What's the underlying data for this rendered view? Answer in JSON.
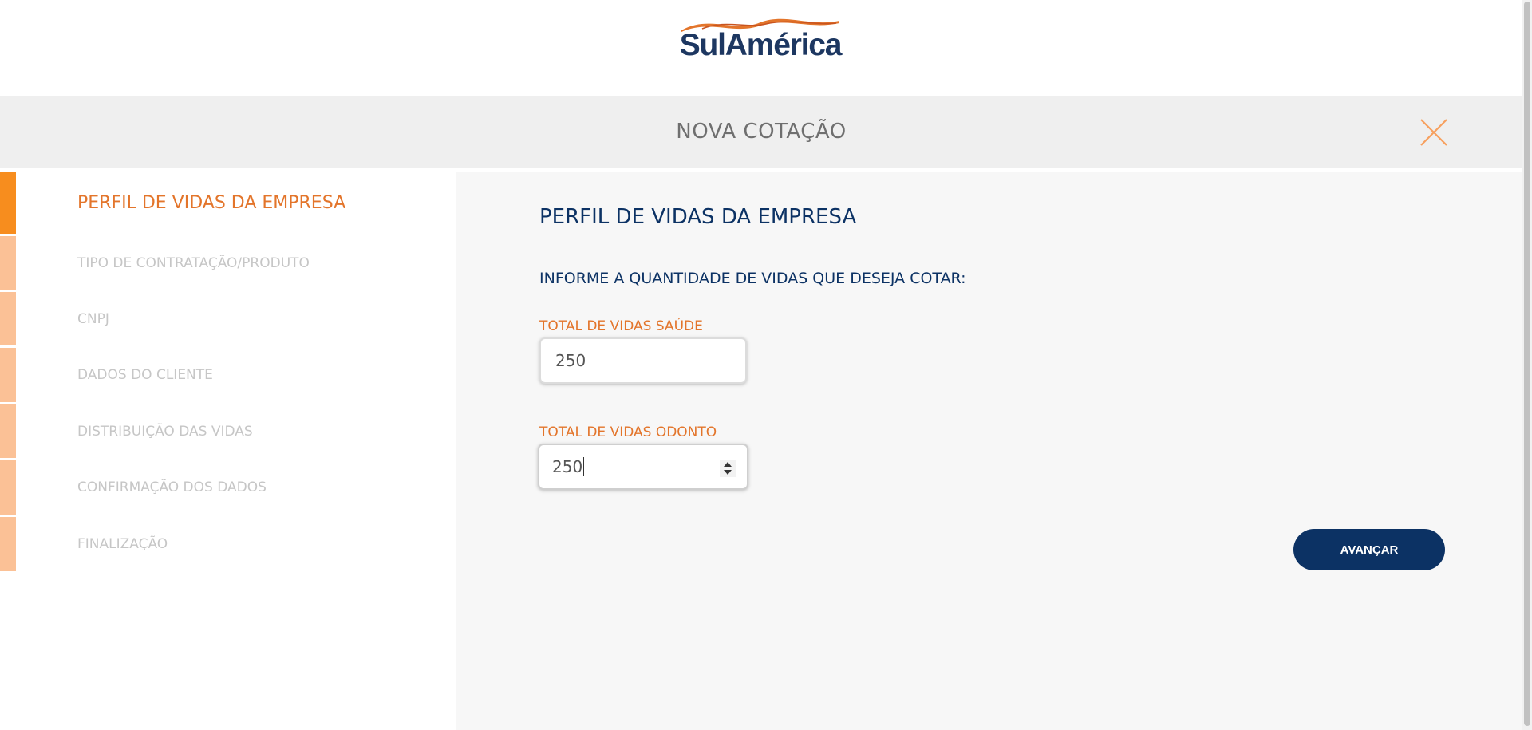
{
  "brand": {
    "name": "SulAmérica",
    "colors": {
      "navy": "#1d3761",
      "orange": "#e3752b",
      "accent": "#f78d1e",
      "button": "#0c3264"
    }
  },
  "header": {
    "title": "NOVA COTAÇÃO",
    "close_icon": "close-icon"
  },
  "steps": [
    {
      "label": "PERFIL DE VIDAS DA EMPRESA",
      "active": true
    },
    {
      "label": "TIPO DE CONTRATAÇÃO/PRODUTO",
      "active": false
    },
    {
      "label": "CNPJ",
      "active": false
    },
    {
      "label": "DADOS DO CLIENTE",
      "active": false
    },
    {
      "label": "DISTRIBUIÇÃO DAS VIDAS",
      "active": false
    },
    {
      "label": "CONFIRMAÇÃO DOS DADOS",
      "active": false
    },
    {
      "label": "FINALIZAÇÃO",
      "active": false
    }
  ],
  "form": {
    "title": "PERFIL DE VIDAS DA EMPRESA",
    "instruction": "INFORME A QUANTIDADE DE VIDAS QUE DESEJA COTAR:",
    "saude": {
      "label": "TOTAL DE VIDAS SAÚDE",
      "value": "250"
    },
    "odonto": {
      "label": "TOTAL DE VIDAS ODONTO",
      "value": "250"
    },
    "next_label": "AVANÇAR"
  }
}
